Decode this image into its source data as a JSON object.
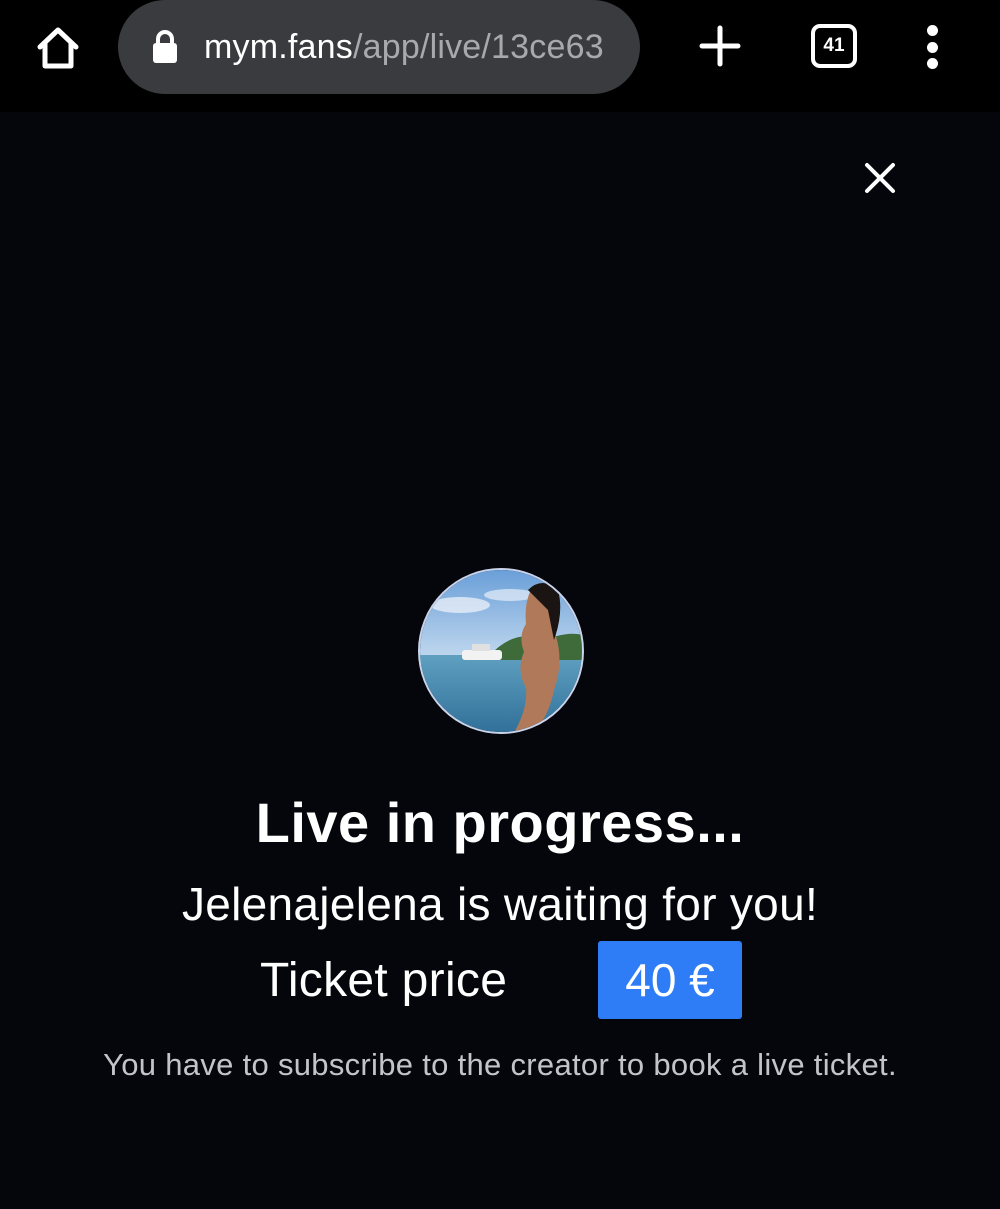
{
  "browser": {
    "url_host": "mym.fans",
    "url_path": "/app/live/13ce63",
    "tab_count": "41",
    "icons": {
      "home": "home-icon",
      "lock": "lock-icon",
      "new_tab": "plus-icon",
      "tabs": "tab-switcher-icon",
      "menu": "more-vert-icon"
    }
  },
  "modal": {
    "close_icon": "close-icon",
    "avatar_icon": "avatar",
    "title": "Live in progress...",
    "subtitle": "Jelenajelena is waiting for you!",
    "price_label": "Ticket price",
    "price_value": "40 €",
    "note": "You have to subscribe to the creator to book a live ticket."
  },
  "colors": {
    "background": "#05060b",
    "url_pill": "#3a3b3f",
    "price_badge": "#2e7cf6",
    "note_text": "#c4c4c8"
  }
}
